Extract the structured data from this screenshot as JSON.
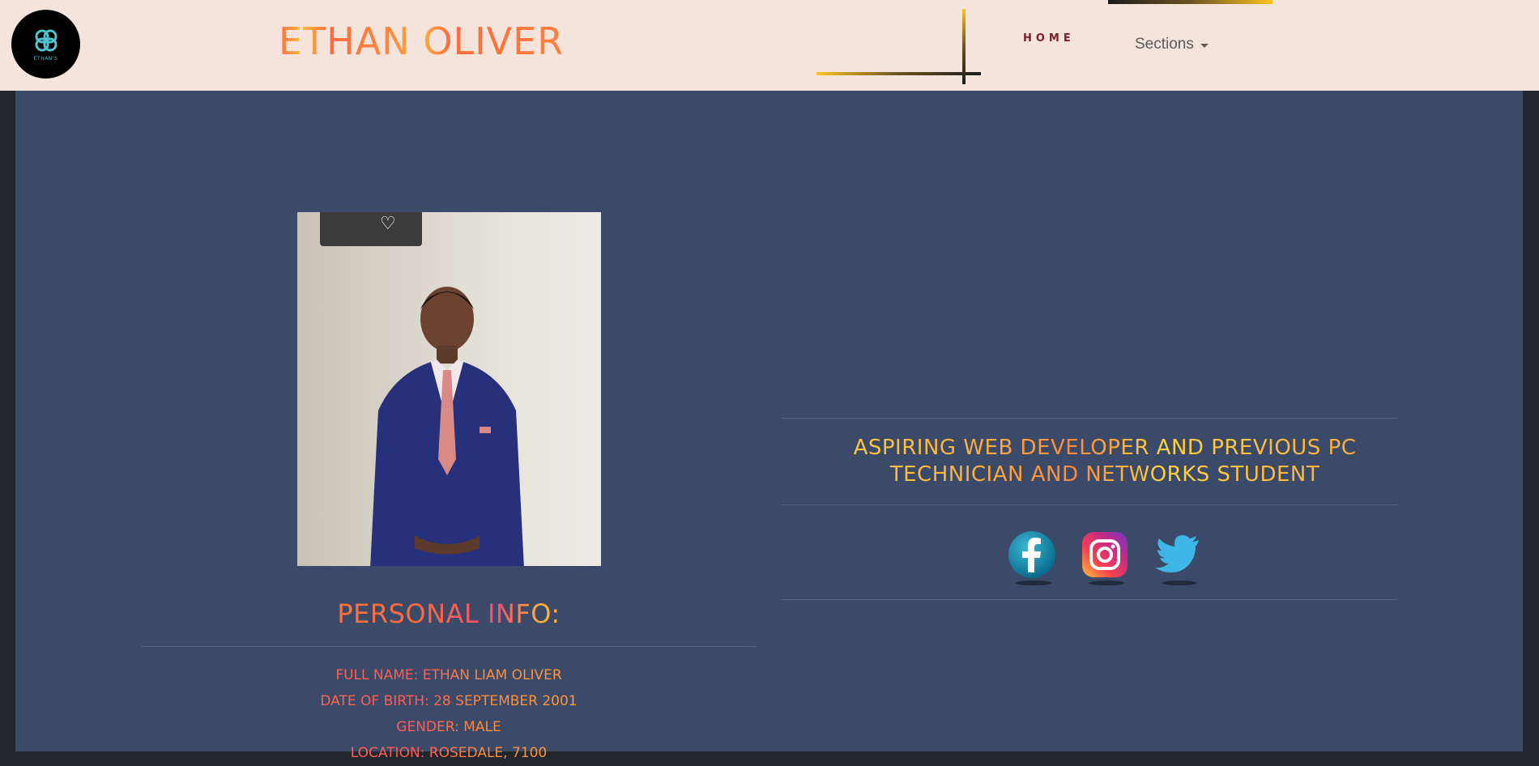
{
  "header": {
    "brand": "ETHAN OLIVER",
    "logo_text": "ETHAN'S",
    "nav": {
      "home": "HOME",
      "sections": "Sections"
    }
  },
  "profile": {
    "personal_info_title": "PERSONAL INFO:",
    "info": [
      "FULL NAME: ETHAN LIAM OLIVER",
      "DATE OF BIRTH: 28 SEPTEMBER 2001",
      "GENDER: MALE",
      "LOCATION: ROSEDALE, 7100"
    ],
    "headline": "ASPIRING WEB DEVELOPER AND PREVIOUS PC TECHNICIAN AND NETWORKS STUDENT"
  },
  "socials": [
    {
      "name": "facebook-icon"
    },
    {
      "name": "instagram-icon"
    },
    {
      "name": "twitter-icon"
    }
  ],
  "colors": {
    "navbar_bg": "#f4e4dc",
    "main_bg": "#3a4a68",
    "page_bg": "#22272d",
    "accent_orange": "#ff7a3d",
    "accent_gold": "#ffc21f",
    "home_link": "#7a1f2b"
  }
}
